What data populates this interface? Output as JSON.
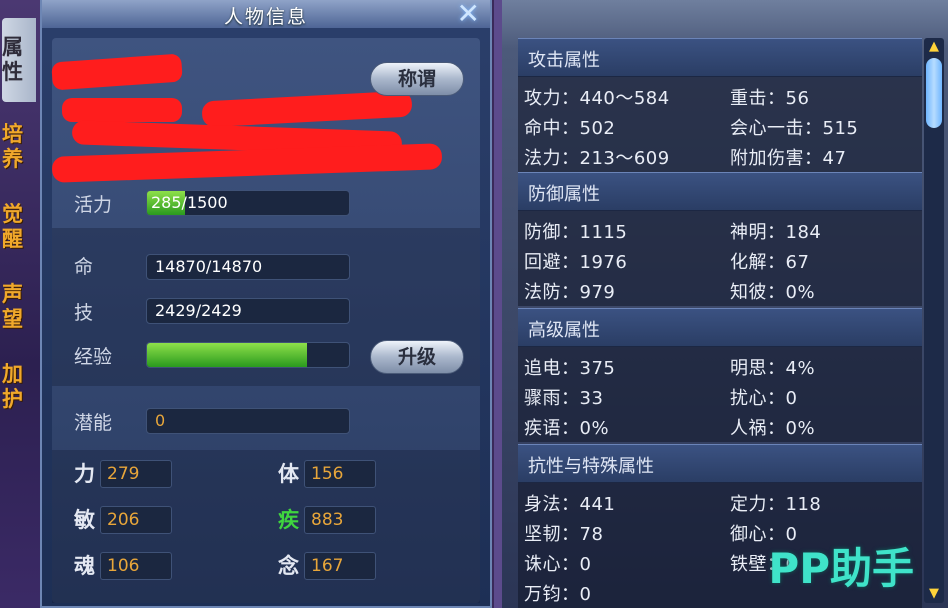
{
  "tabs": [
    "属性",
    "培养",
    "觉醒",
    "声望",
    "加护"
  ],
  "window": {
    "title": "人物信息"
  },
  "profile": {
    "title_button": "称谓"
  },
  "vitals": {
    "vigor": {
      "label": "活力",
      "current": "285/",
      "max": "1500",
      "fraction": 0.19
    },
    "life": {
      "label": "命",
      "value": "14870/14870"
    },
    "skill": {
      "label": "技",
      "value": "2429/2429"
    },
    "exp": {
      "label": "经验",
      "fraction": 0.79
    },
    "levelup_button": "升级",
    "potential": {
      "label": "潜能",
      "value": "0"
    }
  },
  "stats": [
    {
      "label": "力",
      "value": "279",
      "color": "#e4e8f2"
    },
    {
      "label": "体",
      "value": "156",
      "color": "#e4e8f2"
    },
    {
      "label": "敏",
      "value": "206",
      "color": "#e4e8f2"
    },
    {
      "label": "疾",
      "value": "883",
      "color": "#3fd43f"
    },
    {
      "label": "魂",
      "value": "106",
      "color": "#e4e8f2"
    },
    {
      "label": "念",
      "value": "167",
      "color": "#e4e8f2"
    }
  ],
  "attributes": {
    "attack": {
      "title": "攻击属性",
      "items": [
        "攻力：440～584",
        "重击：56",
        "命中：502",
        "会心一击：515",
        "法力：213～609",
        "附加伤害：47"
      ]
    },
    "defense": {
      "title": "防御属性",
      "items": [
        "防御：1115",
        "神明：184",
        "回避：1976",
        "化解：67",
        "法防：979",
        "知彼：0%"
      ]
    },
    "advanced": {
      "title": "高级属性",
      "items": [
        "追电：375",
        "明思：4%",
        "骤雨：33",
        "扰心：0",
        "疾语：0%",
        "人祸：0%"
      ]
    },
    "resist": {
      "title": "抗性与特殊属性",
      "items": [
        "身法：441",
        "定力：118",
        "坚韧：78",
        "御心：0",
        "诛心：0",
        "铁壁：0",
        "万钧：0"
      ]
    }
  },
  "watermark": "PP助手"
}
